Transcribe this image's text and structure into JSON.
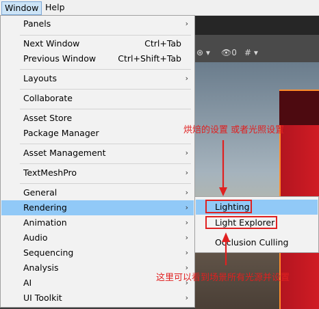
{
  "menubar": {
    "window": "Window",
    "help": "Help"
  },
  "window_menu": {
    "items": [
      {
        "label": "Panels",
        "arrow": "›"
      },
      {
        "label": "Next Window",
        "shortcut": "Ctrl+Tab"
      },
      {
        "label": "Previous Window",
        "shortcut": "Ctrl+Shift+Tab"
      },
      {
        "label": "Layouts",
        "arrow": "›"
      },
      {
        "label": "Collaborate"
      },
      {
        "label": "Asset Store"
      },
      {
        "label": "Package Manager"
      },
      {
        "label": "Asset Management",
        "arrow": "›"
      },
      {
        "label": "TextMeshPro",
        "arrow": "›"
      },
      {
        "label": "General",
        "arrow": "›"
      },
      {
        "label": "Rendering",
        "arrow": "›"
      },
      {
        "label": "Animation",
        "arrow": "›"
      },
      {
        "label": "Audio",
        "arrow": "›"
      },
      {
        "label": "Sequencing",
        "arrow": "›"
      },
      {
        "label": "Analysis",
        "arrow": "›"
      },
      {
        "label": "AI",
        "arrow": "›"
      },
      {
        "label": "UI Toolkit",
        "arrow": "›"
      }
    ]
  },
  "rendering_submenu": {
    "items": [
      {
        "label": "Lighting"
      },
      {
        "label": "Light Explorer"
      },
      {
        "label": "Occlusion Culling"
      }
    ]
  },
  "editor_toolbar": {
    "glyph1": "⊛ ▾",
    "glyph2": "👁0",
    "glyph3": "#  ▾"
  },
  "annotations": {
    "top": "烘焙的设置 或者光照设置",
    "bottom": "这里可以看到场景所有光源并设置"
  },
  "colors": {
    "highlight": "#91c9f7",
    "annotation_red": "#e02020",
    "menu_bg": "#f2f2f2"
  }
}
